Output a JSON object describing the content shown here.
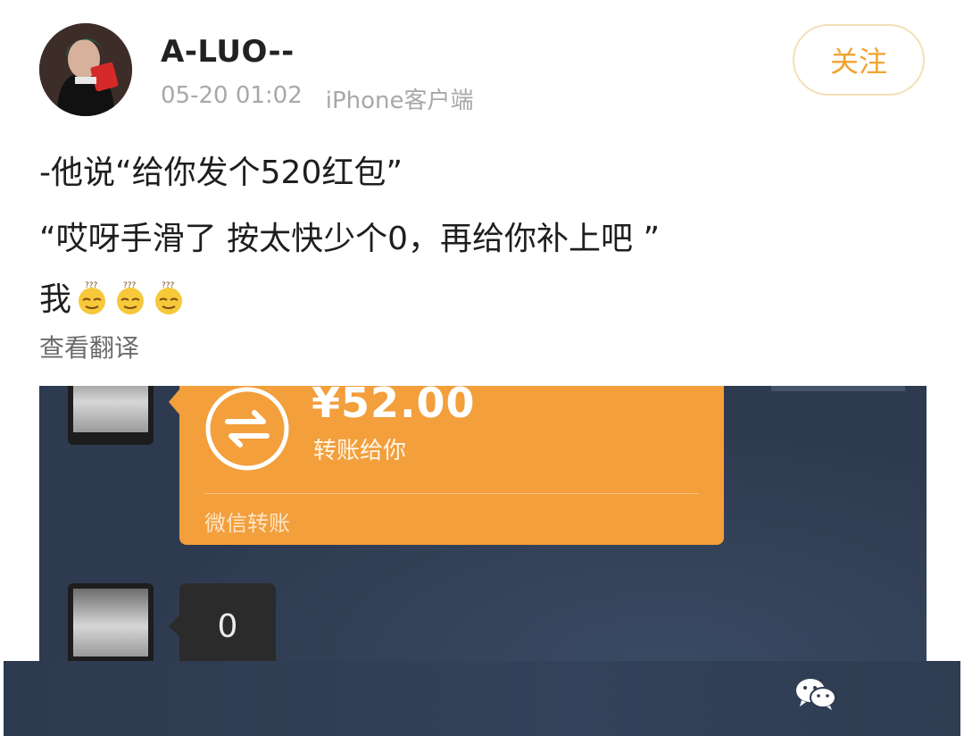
{
  "post": {
    "username": "A-LUO--",
    "date": "05-20 01:02",
    "client": "iPhone客户端",
    "follow_label": "关注",
    "line1": "-他说“给你发个520红包”",
    "line2": "“哎呀手滑了 按太快少个0，再给你补上吧 ”",
    "line3": "我",
    "emoji_name": "dizzy-face-emoji",
    "translate_label": "查看翻译"
  },
  "screenshot": {
    "transfer_amount": "¥52.00",
    "transfer_subtitle": "转账给你",
    "transfer_source": "微信转账",
    "message_text": "0"
  },
  "colors": {
    "accent": "#f0a431",
    "transfer_bubble": "#f39f3c",
    "chat_bg": "#2e3a4f"
  }
}
